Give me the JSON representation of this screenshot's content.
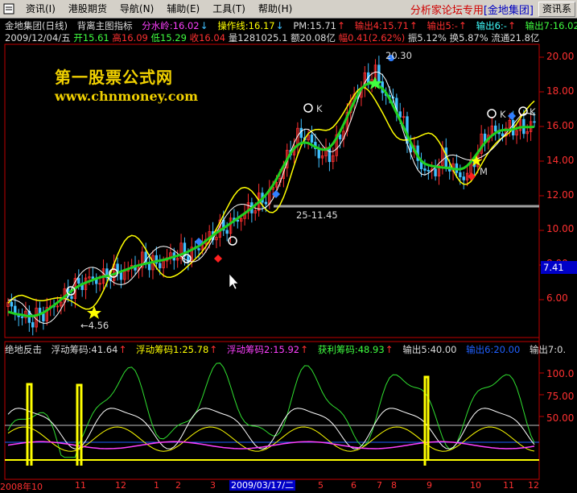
{
  "menubar": {
    "items": [
      "资讯(I)",
      "港股期货",
      "导航(N)",
      "辅助(E)",
      "工具(T)",
      "帮助(H)"
    ],
    "brand": "分析家论坛专用",
    "brand_sub": "[金地集团]",
    "info_button": "资讯系"
  },
  "header": {
    "stock": "金地集团(日线)",
    "indicator": "背离主图指标",
    "fsl_label": "分水岭:16.02",
    "czx_label": "操作线:16.17",
    "pm_label": "PM:15.71",
    "out4": "输出4:15.71",
    "out5": "输出5:-",
    "out6": "输出6:-",
    "out7": "输出7:16.02",
    "date": "2009/12/04/五",
    "open": "开15.61",
    "high": "高16.09",
    "low": "低15.29",
    "close": "收16.04",
    "volume": "量1281025.1",
    "amount": "额20.08亿",
    "change": "幅0.41(2.62%)",
    "amplitude": "振5.12%",
    "turnover": "换5.87%",
    "float": "流通21.8亿"
  },
  "watermark": {
    "line1": "第一股票公式网",
    "line2": "www.chnmoney.com"
  },
  "price_axis": [
    "20.00",
    "18.00",
    "16.00",
    "14.00",
    "12.00",
    "10.00",
    "8.00",
    "6.00"
  ],
  "current_price": "7.41",
  "annotations": {
    "peak": "20.30",
    "support": "25-11.45",
    "bottom": "←4.56",
    "k_label": "K",
    "m_label": "M"
  },
  "lower_header": {
    "name": "绝地反击",
    "f1": "浮动筹码:41.64",
    "f2": "浮动筹码1:25.78",
    "f3": "浮动筹码2:15.92",
    "profit": "获利筹码:48.93",
    "out5": "输出5:40.00",
    "out6": "输出6:20.00",
    "out7": "输出7:0."
  },
  "lower_axis": [
    "100.0",
    "75.00",
    "50.00"
  ],
  "x_axis": {
    "labels": [
      "2008年10",
      "11",
      "12",
      "1",
      "2",
      "3",
      "4",
      "5",
      "6",
      "7",
      "8",
      "9",
      "10",
      "11",
      "12"
    ],
    "cursor_date": "2009/03/17/二"
  },
  "colors": {
    "bg": "#000000",
    "up": "#ff3030",
    "down": "#40c0ff",
    "ma_green": "#20d020",
    "band_yellow": "#ffff00",
    "band_white": "#ffffff",
    "support_gray": "#a0a0a0"
  },
  "chart_data": {
    "type": "line",
    "title": "",
    "ylim": [
      4,
      21
    ],
    "series": [
      {
        "name": "",
        "values": [
          5.6,
          5.1,
          4.8,
          5.2,
          5.6,
          6.2,
          6.8,
          7.2,
          7.1,
          7.6,
          7.5,
          7.9,
          8.3,
          8.0,
          8.4,
          8.7,
          8.6,
          9.3,
          9.8,
          10.2,
          10.6,
          11.2,
          11.6,
          12.2,
          13.5,
          15.2,
          15.6,
          14.5,
          14.2,
          15.3,
          17.5,
          18.4,
          19.2,
          17.8,
          17.2,
          15.1,
          13.8,
          13.2,
          14.2,
          13.4,
          13.0,
          14.5,
          15.8,
          15.6,
          16.0,
          15.8,
          16.2
        ]
      }
    ]
  }
}
